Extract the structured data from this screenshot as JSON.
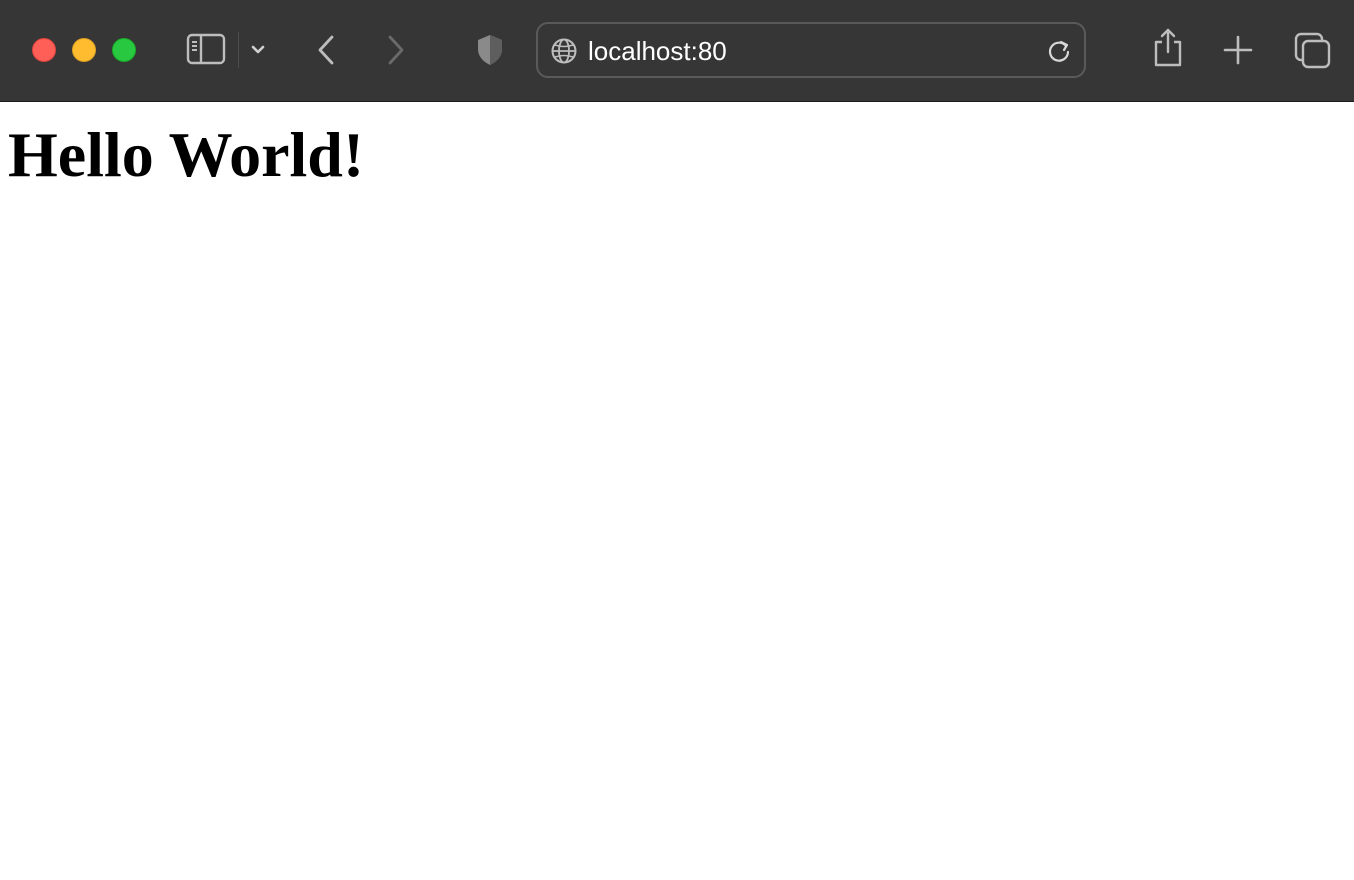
{
  "browser": {
    "toolbar_color": "#363636",
    "traffic_lights": {
      "close": "#ff5f57",
      "minimize": "#febc2e",
      "zoom": "#28c840"
    },
    "address_bar": {
      "url": "localhost:80",
      "leading_icon": "globe-icon",
      "trailing_icon": "reload-icon"
    },
    "icons": [
      "sidebar-icon",
      "chevron-down-icon",
      "back-arrow-icon",
      "forward-arrow-icon",
      "privacy-shield-icon",
      "share-icon",
      "new-tab-icon",
      "tab-overview-icon"
    ]
  },
  "page": {
    "heading": "Hello World!"
  }
}
